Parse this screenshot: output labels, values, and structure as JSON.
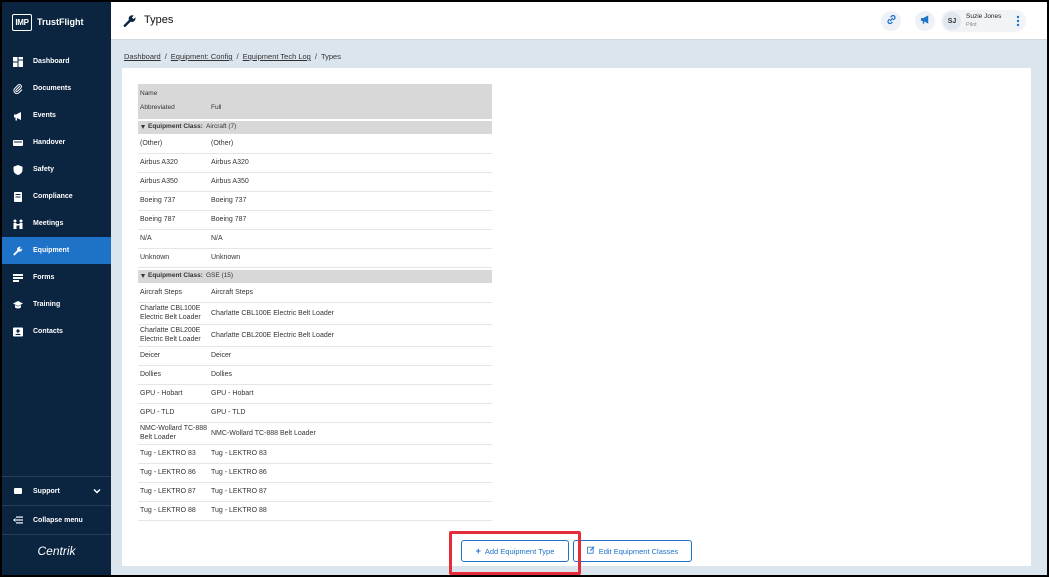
{
  "brand": {
    "logo_text": "IMP",
    "name": "TrustFlight"
  },
  "sidebar": {
    "items": [
      {
        "label": "Dashboard",
        "icon": "dashboard-icon"
      },
      {
        "label": "Documents",
        "icon": "paperclip-icon"
      },
      {
        "label": "Events",
        "icon": "megaphone-icon"
      },
      {
        "label": "Handover",
        "icon": "handover-icon"
      },
      {
        "label": "Safety",
        "icon": "shield-icon"
      },
      {
        "label": "Compliance",
        "icon": "compliance-icon"
      },
      {
        "label": "Meetings",
        "icon": "meetings-icon"
      },
      {
        "label": "Equipment",
        "icon": "wrench-icon",
        "active": true
      },
      {
        "label": "Forms",
        "icon": "forms-icon"
      },
      {
        "label": "Training",
        "icon": "graduation-cap-icon"
      },
      {
        "label": "Contacts",
        "icon": "contacts-icon"
      }
    ],
    "support_label": "Support",
    "collapse_label": "Collapse menu",
    "footer_logo": "Centrik"
  },
  "header": {
    "title": "Types",
    "user_initials": "SJ",
    "user_name": "Suzie Jones",
    "user_role": "Pilot"
  },
  "breadcrumb": {
    "items": [
      "Dashboard",
      "Equipment: Config",
      "Equipment Tech Log"
    ],
    "current": "Types"
  },
  "table": {
    "header_name": "Name",
    "col_abbreviated": "Abbreviated",
    "col_full": "Full",
    "groups": [
      {
        "label": "Equipment Class:",
        "value": "Aircraft (7)",
        "rows": [
          {
            "abbr": "(Other)",
            "full": "(Other)"
          },
          {
            "abbr": "Airbus A320",
            "full": "Airbus A320"
          },
          {
            "abbr": "Airbus A350",
            "full": "Airbus A350"
          },
          {
            "abbr": "Boeing 737",
            "full": "Boeing 737"
          },
          {
            "abbr": "Boeing 787",
            "full": "Boeing 787"
          },
          {
            "abbr": "N/A",
            "full": "N/A"
          },
          {
            "abbr": "Unknown",
            "full": "Unknown"
          }
        ]
      },
      {
        "label": "Equipment Class:",
        "value": "GSE (15)",
        "rows": [
          {
            "abbr": "Aircraft Steps",
            "full": "Aircraft Steps"
          },
          {
            "abbr": "Charlatte CBL100E Electric Belt Loader",
            "full": "Charlatte CBL100E Electric Belt Loader"
          },
          {
            "abbr": "Charlatte CBL200E Electric Belt Loader",
            "full": "Charlatte CBL200E Electric Belt Loader"
          },
          {
            "abbr": "Deicer",
            "full": "Deicer"
          },
          {
            "abbr": "Dollies",
            "full": "Dollies"
          },
          {
            "abbr": "GPU - Hobart",
            "full": "GPU - Hobart"
          },
          {
            "abbr": "GPU - TLD",
            "full": "GPU - TLD"
          },
          {
            "abbr": "NMC-Wollard TC-888 Belt Loader",
            "full": "NMC-Wollard TC-888 Belt Loader"
          },
          {
            "abbr": "Tug - LEKTRO 83",
            "full": "Tug - LEKTRO 83"
          },
          {
            "abbr": "Tug - LEKTRO 86",
            "full": "Tug - LEKTRO 86"
          },
          {
            "abbr": "Tug - LEKTRO 87",
            "full": "Tug - LEKTRO 87"
          },
          {
            "abbr": "Tug - LEKTRO 88",
            "full": "Tug - LEKTRO 88"
          }
        ]
      }
    ]
  },
  "actions": {
    "add_label": "Add Equipment Type",
    "edit_label": "Edit Equipment Classes"
  },
  "colors": {
    "sidebar_bg": "#0b2440",
    "active_item": "#1e73c8",
    "accent": "#1e73c8",
    "highlight": "#e52d3a"
  }
}
